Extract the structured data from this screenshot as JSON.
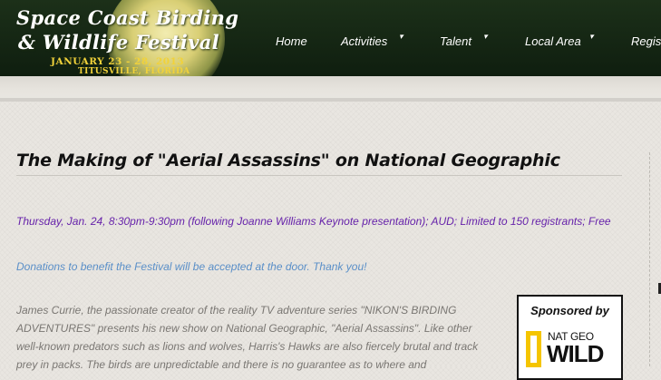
{
  "site": {
    "logo_line1": "Space Coast Birding",
    "logo_line2": "& Wildlife Festival",
    "dates": "January 23 - 28, 2013",
    "location": "Titusville, Florida"
  },
  "nav": {
    "items": [
      {
        "label": "Home",
        "has_dropdown": false
      },
      {
        "label": "Activities",
        "has_dropdown": true
      },
      {
        "label": "Talent",
        "has_dropdown": true
      },
      {
        "label": "Local Area",
        "has_dropdown": true
      },
      {
        "label": "Regist",
        "has_dropdown": false
      }
    ],
    "dropdown_icon": "caret-down-icon"
  },
  "article": {
    "title": "The Making of \"Aerial Assassins\" on National Geographic",
    "event_time": "Thursday, Jan. 24, 8:30pm-9:30pm (following Joanne Williams Keynote presentation); AUD; Limited to 150 registrants; Free",
    "donations": "Donations to benefit the Festival will be accepted at the door. Thank you!",
    "description": "James Currie, the passionate creator of the reality TV adventure series \"NIKON'S BIRDING ADVENTURES\" presents his new show on National Geographic, \"Aerial Assassins\". Like other well-known predators such as lions and wolves, Harris's Hawks are also fiercely brutal and track prey in packs. The birds are unpredictable and there is no guarantee as to where and"
  },
  "sponsor": {
    "label": "Sponsored by",
    "logo_top": "NAT GEO",
    "logo_bottom": "WILD"
  },
  "colors": {
    "header_bg": "#142514",
    "logo_accent": "#f1d23a",
    "event_time": "#6622aa",
    "donations": "#5a8fc8",
    "body_text": "#7a7773",
    "natgeo_yellow": "#f5c500"
  }
}
